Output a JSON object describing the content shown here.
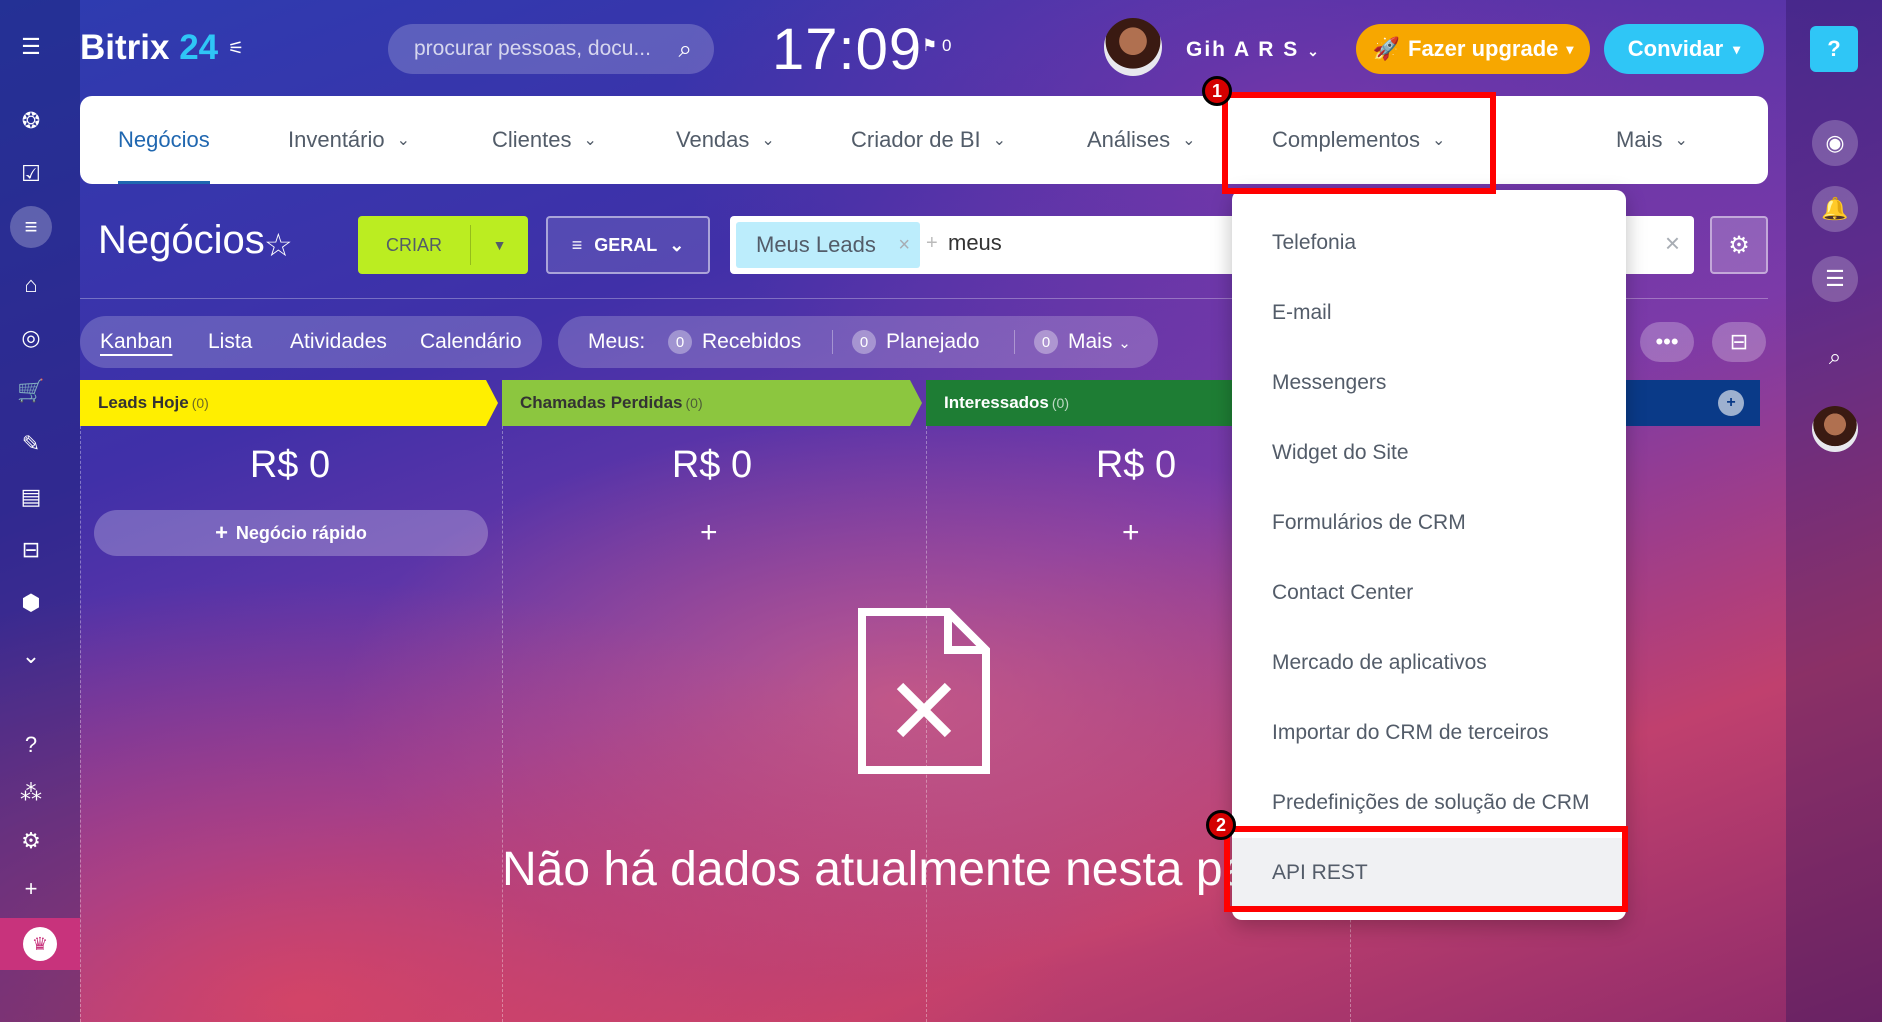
{
  "topbar": {
    "logo_name": "Bitrix",
    "logo_num": "24",
    "search_placeholder": "procurar pessoas, docu...",
    "clock": "17:09",
    "flag_count": "0",
    "username": "Gih A R S",
    "upgrade_label": "Fazer upgrade",
    "invite_label": "Convidar",
    "help_label": "?"
  },
  "nav": {
    "items": [
      {
        "label": "Negócios"
      },
      {
        "label": "Inventário"
      },
      {
        "label": "Clientes"
      },
      {
        "label": "Vendas"
      },
      {
        "label": "Criador de BI"
      },
      {
        "label": "Análises"
      },
      {
        "label": "Complementos"
      },
      {
        "label": "Mais"
      }
    ]
  },
  "page": {
    "title": "Negócios",
    "create_label": "CRIAR",
    "general_label": "GERAL",
    "filter_chip": "Meus Leads",
    "filter_text": "meus"
  },
  "view_tabs": [
    "Kanban",
    "Lista",
    "Atividades",
    "Calendário"
  ],
  "counters": {
    "label": "Meus:",
    "items": [
      {
        "num": "0",
        "label": "Recebidos"
      },
      {
        "num": "0",
        "label": "Planejado"
      },
      {
        "num": "0",
        "label": "Mais"
      }
    ]
  },
  "stages": [
    {
      "name": "Leads Hoje",
      "count": "(0)",
      "color": "#ffef00",
      "text_color": "#333333",
      "sum": "R$ 0"
    },
    {
      "name": "Chamadas Perdidas",
      "count": "(0)",
      "color": "#8cc63f",
      "text_color": "#333333",
      "sum": "R$ 0"
    },
    {
      "name": "Interessados",
      "count": "(0)",
      "color": "#1e7d34",
      "text_color": "#ffffff",
      "sum": "R$ 0"
    }
  ],
  "quick_deal_label": "Negócio rápido",
  "empty_message": "Não há dados atualmente nesta pa",
  "dropdown": {
    "items": [
      "Telefonia",
      "E-mail",
      "Messengers",
      "Widget do Site",
      "Formulários de CRM",
      "Contact Center",
      "Mercado de aplicativos",
      "Importar do CRM de terceiros",
      "Predefinições de solução de CRM",
      "API REST"
    ]
  },
  "annotations": {
    "badge_1": "1",
    "badge_2": "2",
    "highlight_color": "#ff0000"
  }
}
